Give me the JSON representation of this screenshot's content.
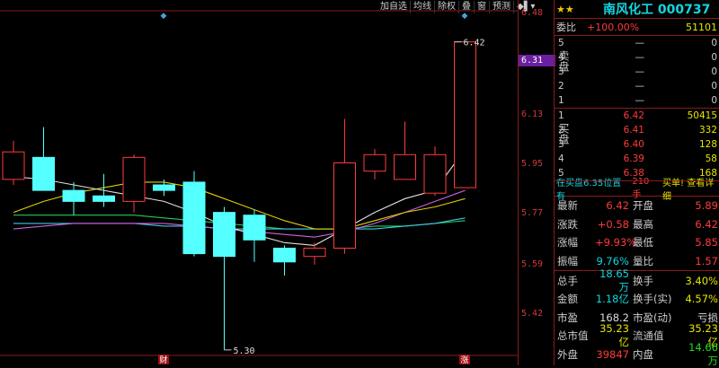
{
  "toolbar": [
    "加自选",
    "均线",
    "除权",
    "叠",
    "窗",
    "预测",
    "◆▌▾"
  ],
  "axis_ticks": [
    "6.48",
    "6.31",
    "6.13",
    "5.95",
    "5.77",
    "5.59",
    "5.42"
  ],
  "axis_current": "6.31",
  "chart_data": {
    "type": "candlestick",
    "ylim": [
      5.28,
      6.52
    ],
    "candles": [
      {
        "o": 5.92,
        "h": 6.06,
        "l": 5.9,
        "c": 6.02
      },
      {
        "o": 6.0,
        "h": 6.11,
        "l": 5.88,
        "c": 5.88
      },
      {
        "o": 5.88,
        "h": 5.91,
        "l": 5.79,
        "c": 5.84
      },
      {
        "o": 5.86,
        "h": 5.94,
        "l": 5.82,
        "c": 5.84
      },
      {
        "o": 5.84,
        "h": 6.01,
        "l": 5.8,
        "c": 6.0
      },
      {
        "o": 5.9,
        "h": 5.92,
        "l": 5.86,
        "c": 5.88
      },
      {
        "o": 5.91,
        "h": 5.95,
        "l": 5.64,
        "c": 5.65
      },
      {
        "o": 5.8,
        "h": 5.82,
        "l": 5.3,
        "c": 5.64
      },
      {
        "o": 5.79,
        "h": 5.81,
        "l": 5.62,
        "c": 5.7
      },
      {
        "o": 5.67,
        "h": 5.68,
        "l": 5.57,
        "c": 5.62
      },
      {
        "o": 5.64,
        "h": 5.69,
        "l": 5.61,
        "c": 5.67
      },
      {
        "o": 5.67,
        "h": 6.14,
        "l": 5.65,
        "c": 5.98
      },
      {
        "o": 5.95,
        "h": 6.03,
        "l": 5.92,
        "c": 6.01
      },
      {
        "o": 5.92,
        "h": 6.13,
        "l": 5.92,
        "c": 6.01
      },
      {
        "o": 5.87,
        "h": 6.04,
        "l": 5.86,
        "c": 6.01
      },
      {
        "o": 5.89,
        "h": 6.42,
        "l": 5.89,
        "c": 6.42
      }
    ],
    "ma_white": [
      5.93,
      5.92,
      5.9,
      5.88,
      5.86,
      5.84,
      5.8,
      5.75,
      5.72,
      5.69,
      5.68,
      5.74,
      5.8,
      5.85,
      5.88,
      6.03
    ],
    "ma_yellow": [
      5.8,
      5.84,
      5.87,
      5.89,
      5.91,
      5.91,
      5.89,
      5.85,
      5.81,
      5.77,
      5.74,
      5.74,
      5.77,
      5.8,
      5.82,
      5.85
    ],
    "ma_magenta": [
      5.74,
      5.75,
      5.76,
      5.76,
      5.76,
      5.76,
      5.75,
      5.74,
      5.73,
      5.72,
      5.71,
      5.73,
      5.76,
      5.8,
      5.84,
      5.88
    ],
    "ma_green": [
      5.79,
      5.79,
      5.79,
      5.79,
      5.79,
      5.78,
      5.77,
      5.76,
      5.75,
      5.74,
      5.74,
      5.74,
      5.75,
      5.75,
      5.76,
      5.77
    ],
    "ma_cyan": [
      5.76,
      5.76,
      5.76,
      5.76,
      5.76,
      5.75,
      5.75,
      5.74,
      5.74,
      5.74,
      5.74,
      5.74,
      5.74,
      5.75,
      5.76,
      5.78
    ],
    "high_label": "6.42",
    "low_label": "5.30",
    "markers": [
      "财",
      "涨"
    ]
  },
  "panel": {
    "stars": "★★",
    "name": "南风化工 000737",
    "weibi_label": "委比",
    "weibi_pct": "+100.00%",
    "weibi_val": "51101",
    "sell_label": "卖盘",
    "buy_label": "买盘",
    "sell": [
      {
        "lv": "5",
        "price": "—",
        "vol": "0"
      },
      {
        "lv": "4",
        "price": "—",
        "vol": "0"
      },
      {
        "lv": "3",
        "price": "—",
        "vol": "0"
      },
      {
        "lv": "2",
        "price": "—",
        "vol": "0"
      },
      {
        "lv": "1",
        "price": "—",
        "vol": "0"
      }
    ],
    "buy": [
      {
        "lv": "1",
        "price": "6.42",
        "vol": "50415"
      },
      {
        "lv": "2",
        "price": "6.41",
        "vol": "332"
      },
      {
        "lv": "3",
        "price": "6.40",
        "vol": "128"
      },
      {
        "lv": "4",
        "price": "6.39",
        "vol": "58"
      },
      {
        "lv": "5",
        "price": "6.38",
        "vol": "168"
      }
    ],
    "note_a": "在买盘6.35位置有",
    "note_b": "210手",
    "note_c": "买单! 查看详细",
    "stats": [
      {
        "k1": "最新",
        "v1": "6.42",
        "c1": "red",
        "k2": "开盘",
        "v2": "5.89",
        "c2": "red"
      },
      {
        "k1": "涨跌",
        "v1": "+0.58",
        "c1": "red",
        "k2": "最高",
        "v2": "6.42",
        "c2": "red"
      },
      {
        "k1": "涨幅",
        "v1": "+9.93%",
        "c1": "red",
        "k2": "最低",
        "v2": "5.85",
        "c2": "red"
      },
      {
        "k1": "振幅",
        "v1": "9.76%",
        "c1": "cyan",
        "k2": "量比",
        "v2": "1.57",
        "c2": "red",
        "sep": true
      },
      {
        "k1": "总手",
        "v1": "18.65万",
        "c1": "cyan",
        "k2": "换手",
        "v2": "3.40%",
        "c2": "yel"
      },
      {
        "k1": "金额",
        "v1": "1.18亿",
        "c1": "cyan",
        "k2": "换手(实)",
        "v2": "4.57%",
        "c2": "yel"
      },
      {
        "k1": "市盈",
        "v1": "168.2",
        "c1": "wht",
        "k2": "市盈(动)",
        "v2": "亏损",
        "c2": "wht"
      },
      {
        "k1": "总市值",
        "v1": "35.23亿",
        "c1": "yel",
        "k2": "流通值",
        "v2": "35.23亿",
        "c2": "yel"
      },
      {
        "k1": "外盘",
        "v1": "39847",
        "c1": "red",
        "k2": "内盘",
        "v2": "14.66万",
        "c2": "grn"
      }
    ]
  }
}
